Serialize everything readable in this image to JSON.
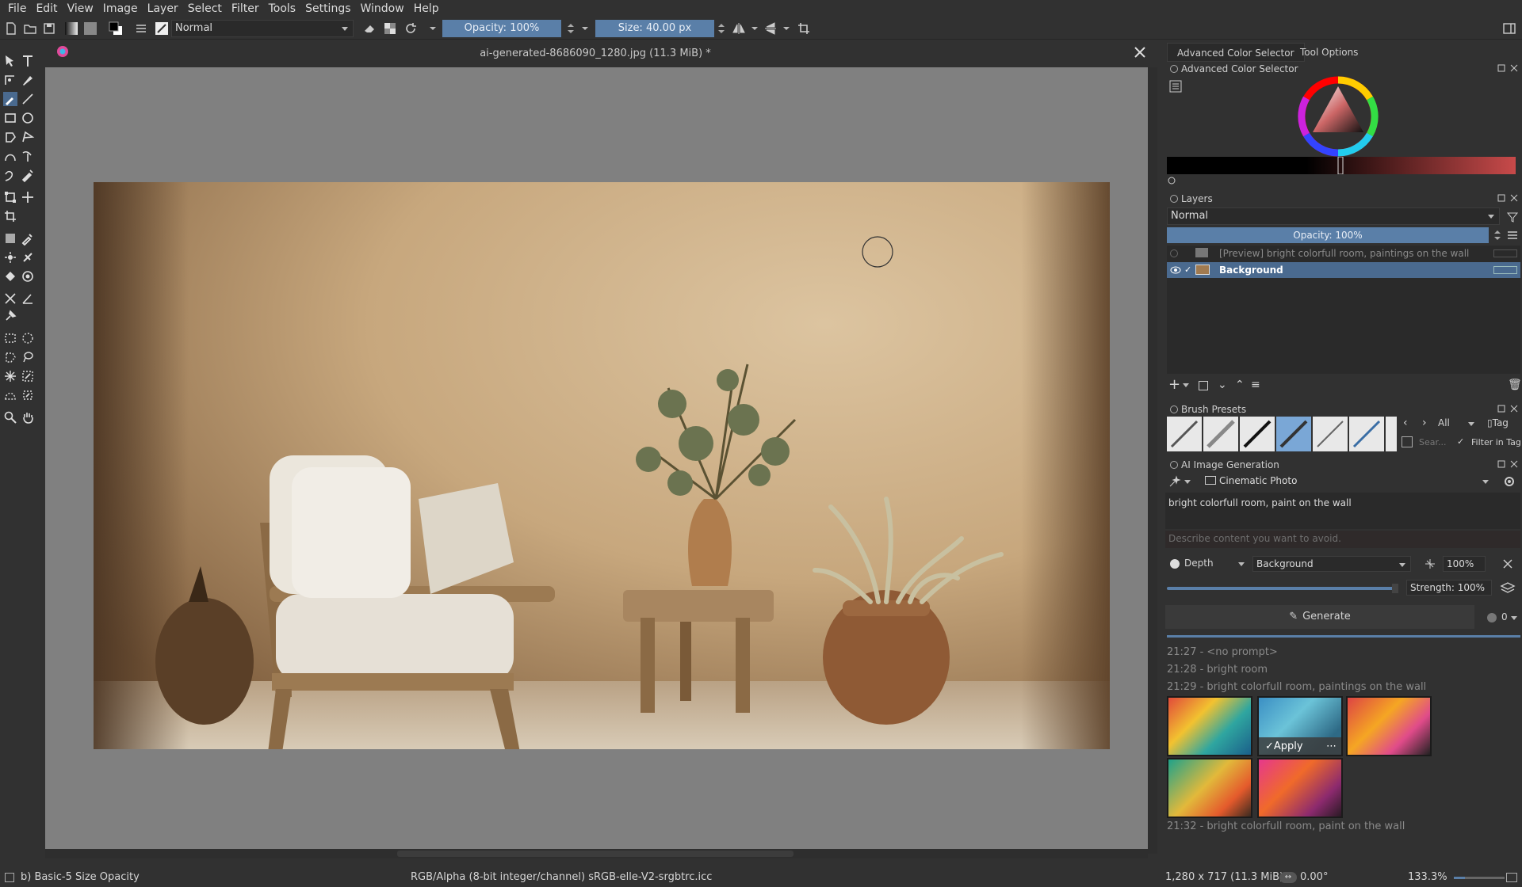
{
  "menu": [
    "File",
    "Edit",
    "View",
    "Image",
    "Layer",
    "Select",
    "Filter",
    "Tools",
    "Settings",
    "Window",
    "Help"
  ],
  "toolbar": {
    "blend_mode": "Normal",
    "opacity": "Opacity: 100%",
    "size": "Size: 40.00 px"
  },
  "document": {
    "title": "ai-generated-8686090_1280.jpg (11.3 MiB) *"
  },
  "tabs": {
    "color": "Advanced Color Selector",
    "tool_options": "Tool Options"
  },
  "color_selector": {
    "title": "Advanced Color Selector"
  },
  "layers": {
    "title": "Layers",
    "blend": "Normal",
    "opacity": "Opacity:  100%",
    "items": [
      {
        "name": "[Preview] bright colorfull room, paintings on the wall",
        "selected": false
      },
      {
        "name": "Background",
        "selected": true
      }
    ]
  },
  "brush_presets": {
    "title": "Brush Presets",
    "tag_filter": "All",
    "tag_label": "Tag",
    "search_placeholder": "Sear...",
    "filter_in_tag": "Filter in Tag"
  },
  "ai": {
    "title": "AI Image Generation",
    "style": "Cinematic Photo",
    "prompt": "bright colorfull room, paint on the wall",
    "negative_placeholder": "Describe content you want to avoid.",
    "control_type": "Depth",
    "control_layer": "Background",
    "control_strength_pct": "100%",
    "strength": "Strength: 100%",
    "generate": "Generate",
    "queue_count": "0",
    "history": [
      "21:27 - <no prompt>",
      "21:28 - bright room",
      "21:29 - bright colorfull room, paintings on the wall"
    ],
    "apply": "Apply",
    "last_history": "21:32 - bright colorfull room, paint on the wall"
  },
  "status": {
    "brush": "b) Basic-5 Size Opacity",
    "color_space": "RGB/Alpha (8-bit integer/channel)  sRGB-elle-V2-srgbtrc.icc",
    "dimensions": "1,280 x 717 (11.3 MiB)",
    "rotation": "0.00°",
    "zoom": "133.3%"
  },
  "colors": {
    "accent": "#5a7fa8",
    "selected_layer": "#4a6a8f",
    "bg": "#313131"
  }
}
